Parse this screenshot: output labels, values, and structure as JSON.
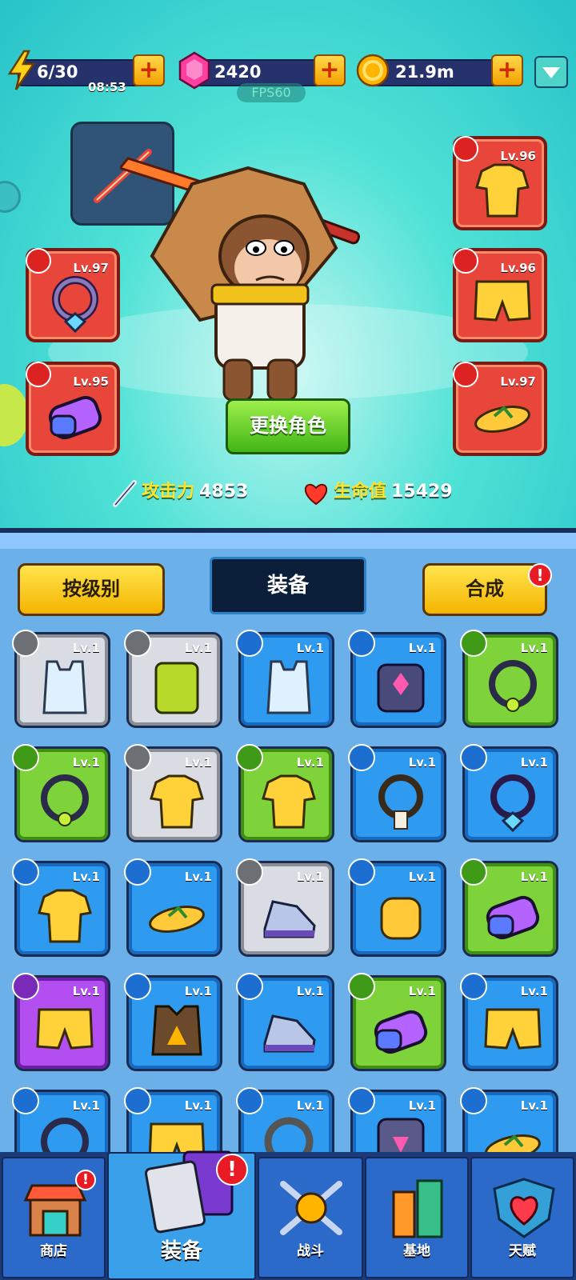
{
  "resources": {
    "energy": "6/30",
    "energy_timer": "08:53",
    "gems": "2420",
    "coins": "21.9m",
    "fps": "FPS60"
  },
  "character": {
    "change_button": "更换角色",
    "attack_label": "攻击力",
    "attack_value": "4853",
    "hp_label": "生命值",
    "hp_value": "15429"
  },
  "equipped": {
    "necklace": "Lv.97",
    "gloves": "Lv.95",
    "shirt": "Lv.96",
    "shorts": "Lv.96",
    "shoes": "Lv.97"
  },
  "inventory": {
    "sort_label": "按级别",
    "tab_title": "装备",
    "merge_label": "合成",
    "merge_alert": "!",
    "items": [
      {
        "rarity": "gray",
        "category": "shirt",
        "item": "tank-top",
        "level": "Lv.1"
      },
      {
        "rarity": "gray",
        "category": "shorts",
        "item": "cargo-shorts",
        "level": "Lv.1"
      },
      {
        "rarity": "blue",
        "category": "shirt",
        "item": "tank-top",
        "level": "Lv.1"
      },
      {
        "rarity": "blue",
        "category": "shirt",
        "item": "armor",
        "level": "Lv.1"
      },
      {
        "rarity": "green",
        "category": "necklace",
        "item": "necklace",
        "level": "Lv.1"
      },
      {
        "rarity": "green",
        "category": "necklace",
        "item": "necklace",
        "level": "Lv.1"
      },
      {
        "rarity": "gray",
        "category": "shirt",
        "item": "hawaiian-shirt",
        "level": "Lv.1"
      },
      {
        "rarity": "green",
        "category": "shirt",
        "item": "hawaiian-shirt",
        "level": "Lv.1"
      },
      {
        "rarity": "blue",
        "category": "necklace",
        "item": "tag-necklace",
        "level": "Lv.1"
      },
      {
        "rarity": "blue",
        "category": "necklace",
        "item": "gem-necklace",
        "level": "Lv.1"
      },
      {
        "rarity": "blue",
        "category": "shirt",
        "item": "hawaiian-shirt",
        "level": "Lv.1"
      },
      {
        "rarity": "blue",
        "category": "shoes",
        "item": "flip-flops",
        "level": "Lv.1"
      },
      {
        "rarity": "gray",
        "category": "shoes",
        "item": "sneaker",
        "level": "Lv.1"
      },
      {
        "rarity": "blue",
        "category": "gloves",
        "item": "glove",
        "level": "Lv.1"
      },
      {
        "rarity": "green",
        "category": "gloves",
        "item": "gauntlet",
        "level": "Lv.1"
      },
      {
        "rarity": "purple",
        "category": "shorts",
        "item": "swim-shorts",
        "level": "Lv.1"
      },
      {
        "rarity": "blue",
        "category": "shirt",
        "item": "vest",
        "level": "Lv.1"
      },
      {
        "rarity": "blue",
        "category": "shoes",
        "item": "sneaker",
        "level": "Lv.1"
      },
      {
        "rarity": "green",
        "category": "gloves",
        "item": "gauntlet",
        "level": "Lv.1"
      },
      {
        "rarity": "blue",
        "category": "shorts",
        "item": "swim-shorts",
        "level": "Lv.1"
      },
      {
        "rarity": "blue",
        "category": "necklace",
        "item": "necklace",
        "level": "Lv.1"
      },
      {
        "rarity": "blue",
        "category": "shorts",
        "item": "swim-shorts",
        "level": "Lv.1"
      },
      {
        "rarity": "blue",
        "category": "necklace",
        "item": "chain",
        "level": "Lv.1"
      },
      {
        "rarity": "blue",
        "category": "shorts",
        "item": "armor-pants",
        "level": "Lv.1"
      },
      {
        "rarity": "blue",
        "category": "shoes",
        "item": "flip-flops",
        "level": "Lv.1"
      }
    ]
  },
  "nav": {
    "shop": "商店",
    "equipment": "装备",
    "battle": "战斗",
    "base": "基地",
    "talent": "天赋",
    "alert": "!"
  },
  "colors": {
    "gray": "#d9dde3",
    "blue": "#2e9bf0",
    "green": "#7ed23a",
    "purple": "#b34ef0",
    "red": "#e8453b"
  }
}
